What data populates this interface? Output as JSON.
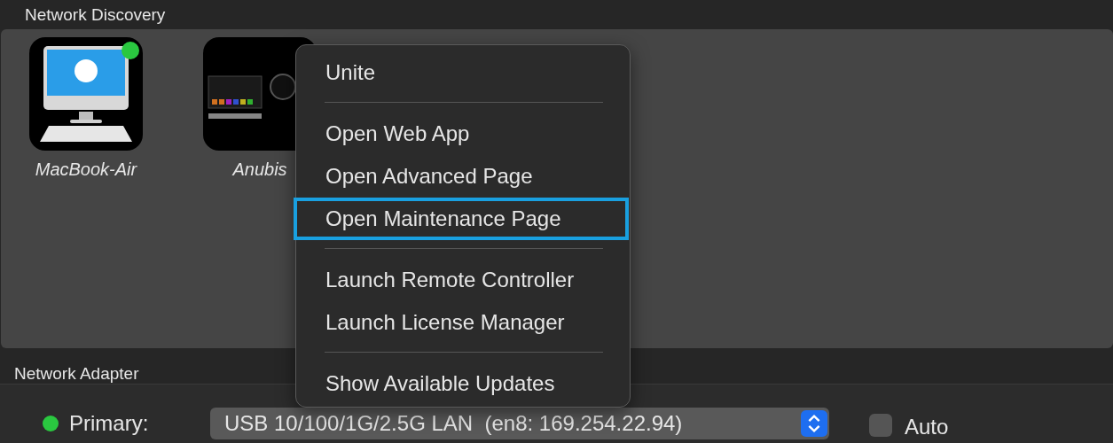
{
  "discovery": {
    "title": "Network Discovery",
    "devices": [
      {
        "name": "MacBook-Air",
        "kind": "computer",
        "online": true
      },
      {
        "name": "Anubis",
        "kind": "interface",
        "online": false
      }
    ]
  },
  "context_menu": {
    "items": [
      {
        "kind": "item",
        "label": "Unite",
        "selected": false
      },
      {
        "kind": "separator"
      },
      {
        "kind": "item",
        "label": "Open Web App",
        "selected": false
      },
      {
        "kind": "item",
        "label": "Open Advanced Page",
        "selected": false
      },
      {
        "kind": "item",
        "label": "Open Maintenance Page",
        "selected": true
      },
      {
        "kind": "separator"
      },
      {
        "kind": "item",
        "label": "Launch Remote Controller",
        "selected": false
      },
      {
        "kind": "item",
        "label": "Launch License Manager",
        "selected": false
      },
      {
        "kind": "separator"
      },
      {
        "kind": "item",
        "label": "Show Available Updates",
        "selected": false
      }
    ]
  },
  "adapter": {
    "title": "Network Adapter",
    "status_on": true,
    "label": "Primary:",
    "value": "USB 10/100/1G/2.5G LAN  (en8: 169.254.22.94)",
    "auto": {
      "label": "Auto",
      "checked": false
    }
  }
}
